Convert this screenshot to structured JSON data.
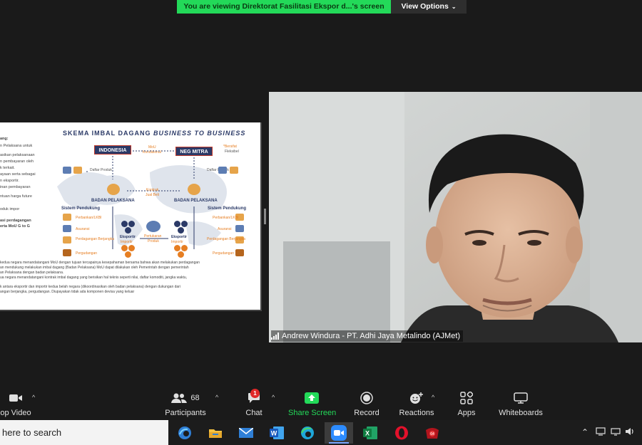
{
  "banner": {
    "viewing_text": "You are viewing Direktorat Fasilitasi Ekspor d...'s screen",
    "view_options": "View Options"
  },
  "slide": {
    "title_main": "SKEMA IMBAL DAGANG ",
    "title_italic": "BUSINESS TO BUSINESS",
    "indonesia": "INDONESIA",
    "neg_mitra": "NEG MITRA",
    "mou": "MoU",
    "kondisional": "Kondisional",
    "bersifat": "*Bersifat",
    "fleksibel": "Fleksibel",
    "daftar_produk": "Daftar Produk",
    "kontrak": "Kontrak",
    "jual_beli": "Jual Beli",
    "badan_pelaksana": "BADAN PELAKSANA",
    "sistem_pendukung": "Sistem Pendukung",
    "perbankan": "Perbankan/LKBI",
    "asuransi": "Asuransi",
    "perdagangan_berjangka": "Perdagangan Berjangka",
    "pergudangan": "Pergudangan",
    "eksportir": "Eksportir",
    "importir": "Importir",
    "pertukaran": "Pertukaran",
    "produk": "Produk",
    "left_lines": [
      "ang:",
      "n Pelaksana untuk",
      "asikan pelaksanaan",
      "n pembayaran oleh",
      "k terkait.",
      "ayaan serta sebagai",
      "n eksportir.",
      "inan pembayaran",
      "ntuan harga future",
      "oduk impor",
      "asi perdagangan",
      "erta MoU G to G"
    ],
    "foot_lines": [
      "kedua negara menandatangani MoU dengan tujuan tercapainya kesepahaman bersama bahwa akan melakukan perdagangan",
      "an mendukung melakukan imbal dagang (Badan Pelaksana) MoU dapat dilakukan oleh Pemerintah dengan pemerintah",
      "an Pelaksana dengan badan pelaksana.",
      "ua negara menandatangani kontrak imbal dagang yang berisikan hal teknis seperti nilai, daftar komoditi, jangka waktu,",
      "k antara eksportir dan importir kedua belah negara (dikoordinasikan oleh badan pelaksana) dengan dukungan dari",
      "angan berjangka, pergudangan. Diupayakan tidak ada komponen devisa yang keluar"
    ]
  },
  "camera": {
    "participant_name": "Andrew Windura - PT. Adhi Jaya Metalindo (AJMet)"
  },
  "toolbar": {
    "video_label": "op Video",
    "participants_label": "Participants",
    "participants_count": "68",
    "chat_label": "Chat",
    "chat_badge": "1",
    "share_label": "Share Screen",
    "record_label": "Record",
    "reactions_label": "Reactions",
    "apps_label": "Apps",
    "whiteboards_label": "Whiteboards",
    "share_color": "#23d959"
  },
  "taskbar": {
    "search_text": "here to search",
    "apps": [
      "edge-chromium-icon",
      "file-explorer-icon",
      "mail-icon",
      "word-icon",
      "edge-icon",
      "zoom-icon",
      "excel-icon",
      "opera-icon",
      "game-icon"
    ]
  }
}
